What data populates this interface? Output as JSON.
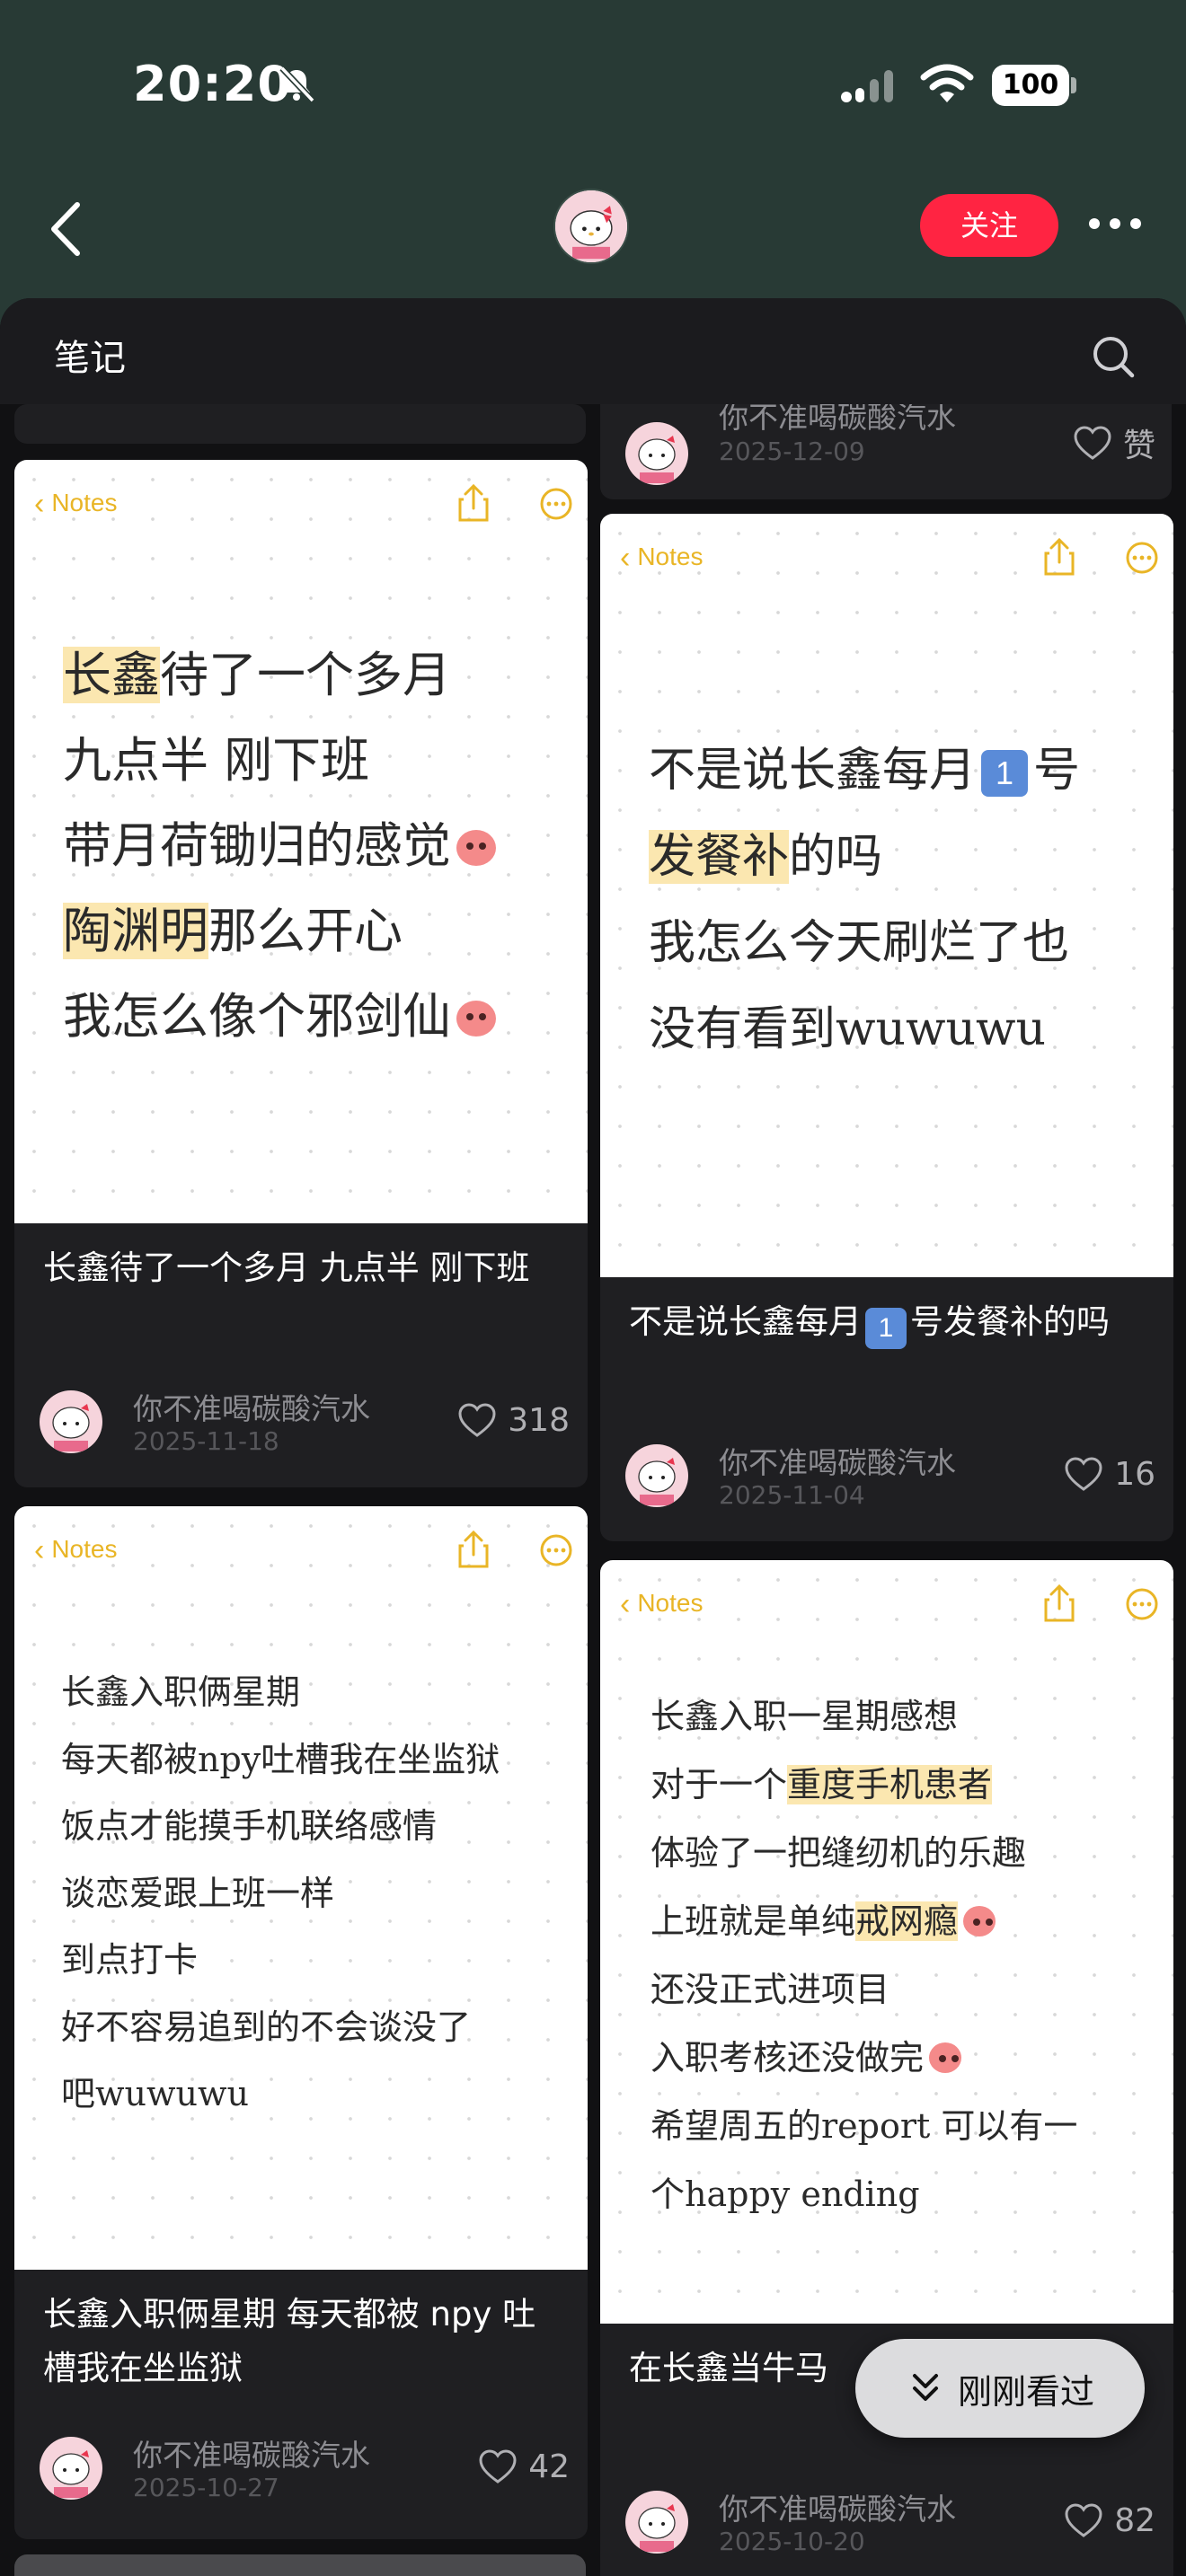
{
  "status_bar": {
    "time": "20:20",
    "battery": "100"
  },
  "header": {
    "follow_label": "关注"
  },
  "section": {
    "title": "笔记"
  },
  "colors": {
    "follow_button": "#ff2442",
    "header_bg": "#283a35",
    "notes_accent": "#e9b526",
    "highlight": "#fbe7b0"
  },
  "notes_app": {
    "back_label": "Notes"
  },
  "top_right_partial": {
    "author": "你不准喝碳酸汽水",
    "date": "2025-12-09",
    "like_label": "赞"
  },
  "cards": [
    {
      "note_lines": [
        {
          "hl": "长鑫",
          "rest": "待了一个多月"
        },
        {
          "pre": "九点半 刚下班"
        },
        {
          "pre": "带月荷锄归的感觉",
          "emoji": true
        },
        {
          "hl": "陶渊明",
          "rest": "那么开心"
        },
        {
          "pre": "我怎么像个邪剑仙",
          "emoji": true
        }
      ],
      "title": "长鑫待了一个多月 九点半 刚下班",
      "author": "你不准喝碳酸汽水",
      "date": "2025-11-18",
      "likes": "318"
    },
    {
      "note_lines": [
        {
          "pre": "不是说长鑫每月",
          "keycap": "1",
          "rest": "号"
        },
        {
          "hl": "发餐补",
          "rest": "的吗"
        },
        {
          "pre": "我怎么今天刷烂了也"
        },
        {
          "pre": "没有看到wuwuwu"
        }
      ],
      "title_pre": "不是说长鑫每月",
      "title_keycap": "1",
      "title_rest": "号发餐补的吗",
      "author": "你不准喝碳酸汽水",
      "date": "2025-11-04",
      "likes": "16"
    },
    {
      "note_lines": [
        {
          "pre": "长鑫入职俩星期"
        },
        {
          "pre": "每天都被npy吐槽我在坐监狱"
        },
        {
          "pre": "饭点才能摸手机联络感情"
        },
        {
          "pre": "谈恋爱跟上班一样"
        },
        {
          "pre": "到点打卡"
        },
        {
          "pre": "好不容易追到的不会谈没了"
        },
        {
          "pre": "吧wuwuwu"
        }
      ],
      "title": "长鑫入职俩星期 每天都被 npy 吐槽我在坐监狱",
      "author": "你不准喝碳酸汽水",
      "date": "2025-10-27",
      "likes": "42"
    },
    {
      "note_lines": [
        {
          "pre": "长鑫入职一星期感想"
        },
        {
          "pre": "对于一个",
          "hl": "重度手机患者"
        },
        {
          "pre": "体验了一把缝纫机的乐趣"
        },
        {
          "pre": "上班就是单纯",
          "hl": "戒网瘾",
          "emoji": true
        },
        {
          "pre": "还没正式进项目"
        },
        {
          "pre": "入职考核还没做完",
          "emoji": true
        },
        {
          "pre": "希望周五的report 可以有一"
        },
        {
          "pre": "个happy ending"
        }
      ],
      "title": "在长鑫当牛马",
      "author": "你不准喝碳酸汽水",
      "date": "2025-10-20",
      "likes": "82"
    }
  ],
  "recent_button": {
    "label": "刚刚看过"
  }
}
